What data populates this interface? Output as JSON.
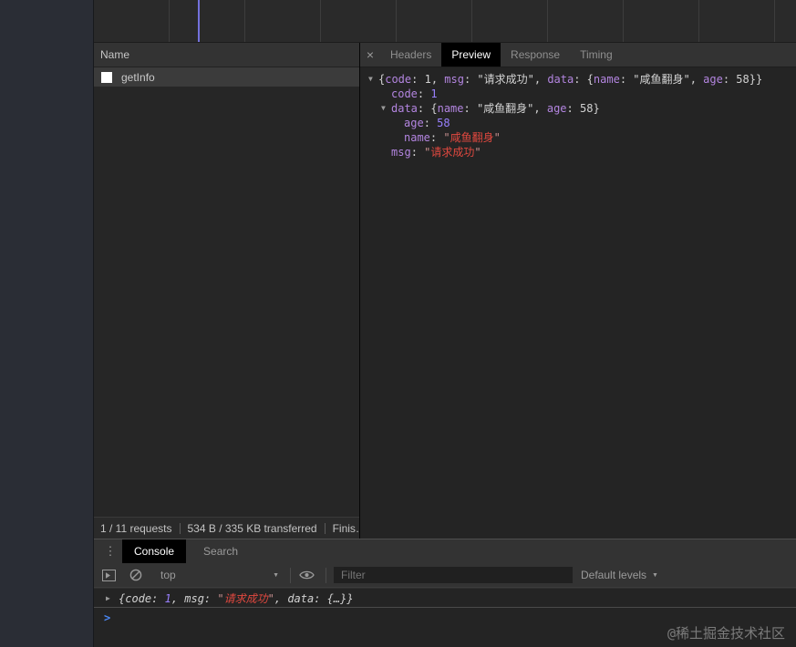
{
  "icons": {
    "close": "×",
    "kebab": "⋮",
    "caret_down": "▼",
    "tree_expanded": "▼",
    "log_collapsed": "▶",
    "prompt": ">"
  },
  "network": {
    "name_column_header": "Name",
    "requests": [
      {
        "name": "getInfo"
      }
    ],
    "summary": [
      "1 / 11 requests",
      "534 B / 335 KB transferred",
      "Finis…"
    ]
  },
  "detail": {
    "tabs": [
      {
        "label": "Headers",
        "active": false
      },
      {
        "label": "Preview",
        "active": true
      },
      {
        "label": "Response",
        "active": false
      },
      {
        "label": "Timing",
        "active": false
      }
    ],
    "preview_tree": {
      "lines": [
        {
          "indent": 0,
          "arrow": "▼",
          "tokens": [
            [
              "p",
              "{"
            ],
            [
              "k",
              "code"
            ],
            [
              "p",
              ": 1, "
            ],
            [
              "k",
              "msg"
            ],
            [
              "p",
              ": \"请求成功\", "
            ],
            [
              "k",
              "data"
            ],
            [
              "p",
              ": {"
            ],
            [
              "k",
              "name"
            ],
            [
              "p",
              ": \"咸鱼翻身\", "
            ],
            [
              "k",
              "age"
            ],
            [
              "p",
              ": 58}}"
            ]
          ]
        },
        {
          "indent": 1,
          "arrow": "",
          "tokens": [
            [
              "k",
              "code"
            ],
            [
              "p",
              ": "
            ],
            [
              "n",
              "1"
            ]
          ]
        },
        {
          "indent": 1,
          "arrow": "▼",
          "tokens": [
            [
              "k",
              "data"
            ],
            [
              "p",
              ": {"
            ],
            [
              "k",
              "name"
            ],
            [
              "p",
              ": \"咸鱼翻身\", "
            ],
            [
              "k",
              "age"
            ],
            [
              "p",
              ": 58}"
            ]
          ]
        },
        {
          "indent": 2,
          "arrow": "",
          "tokens": [
            [
              "k",
              "age"
            ],
            [
              "p",
              ": "
            ],
            [
              "n",
              "58"
            ]
          ]
        },
        {
          "indent": 2,
          "arrow": "",
          "tokens": [
            [
              "k",
              "name"
            ],
            [
              "p",
              ": "
            ],
            [
              "q",
              "\""
            ],
            [
              "r",
              "咸鱼翻身"
            ],
            [
              "q",
              "\""
            ]
          ]
        },
        {
          "indent": 1,
          "arrow": "",
          "tokens": [
            [
              "k",
              "msg"
            ],
            [
              "p",
              ": "
            ],
            [
              "q",
              "\""
            ],
            [
              "r",
              "请求成功"
            ],
            [
              "q",
              "\""
            ]
          ]
        }
      ]
    }
  },
  "console": {
    "tabs": [
      {
        "label": "Console",
        "active": true
      },
      {
        "label": "Search",
        "active": false
      }
    ],
    "toolbar": {
      "context": "top",
      "filter_placeholder": "Filter",
      "levels_label": "Default levels"
    },
    "log_tokens": [
      [
        "p",
        "{code: "
      ],
      [
        "n",
        "1"
      ],
      [
        "p",
        ", msg: "
      ],
      [
        "q",
        "\""
      ],
      [
        "r",
        "请求成功"
      ],
      [
        "q",
        "\""
      ],
      [
        "p",
        ", data: {…}}"
      ]
    ]
  },
  "page": {
    "watermark": "@稀土掘金技术社区"
  },
  "colors": {
    "accent_blue": "#4a88f7",
    "key_purple": "#b385e0",
    "number_purple": "#9980ff",
    "string_red": "#e0483f",
    "timeline_marker": "#7472dd"
  }
}
